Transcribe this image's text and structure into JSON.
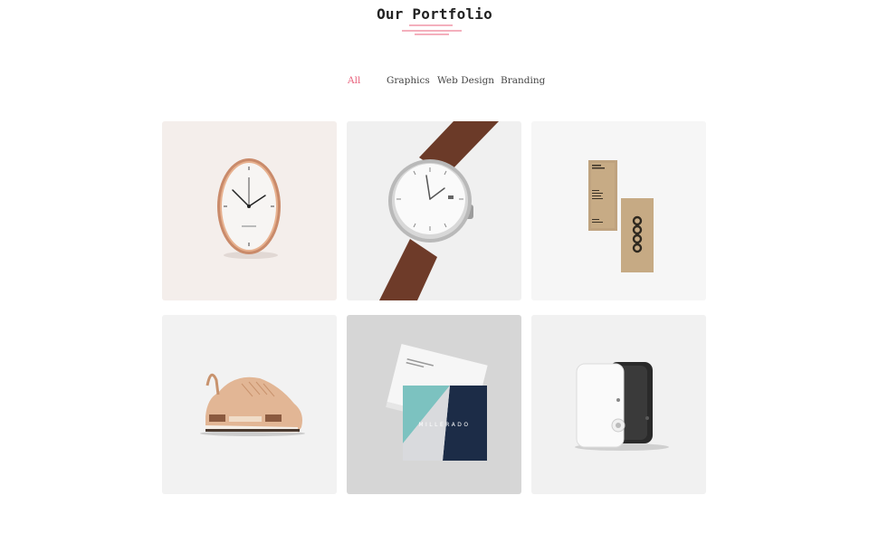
{
  "header": {
    "title": "Our Portfolio",
    "accent_color": "#e8607b"
  },
  "filters": [
    {
      "label": "All",
      "active": true
    },
    {
      "label": "Graphics",
      "active": false
    },
    {
      "label": "Web Design",
      "active": false
    },
    {
      "label": "Branding",
      "active": false
    }
  ],
  "portfolio_items": [
    {
      "subject": "copper-wall-clock",
      "background": "#f4eeeb"
    },
    {
      "subject": "wristwatch-brown-strap",
      "background": "#f0f0f0"
    },
    {
      "subject": "kraft-business-cards",
      "background": "#f6f6f6"
    },
    {
      "subject": "leather-sneaker",
      "background": "#f2f2f2"
    },
    {
      "subject": "geometric-business-cards",
      "background": "#d6d6d6",
      "card_text": "MILLERADO"
    },
    {
      "subject": "black-white-device",
      "background": "#f1f1f1"
    }
  ]
}
